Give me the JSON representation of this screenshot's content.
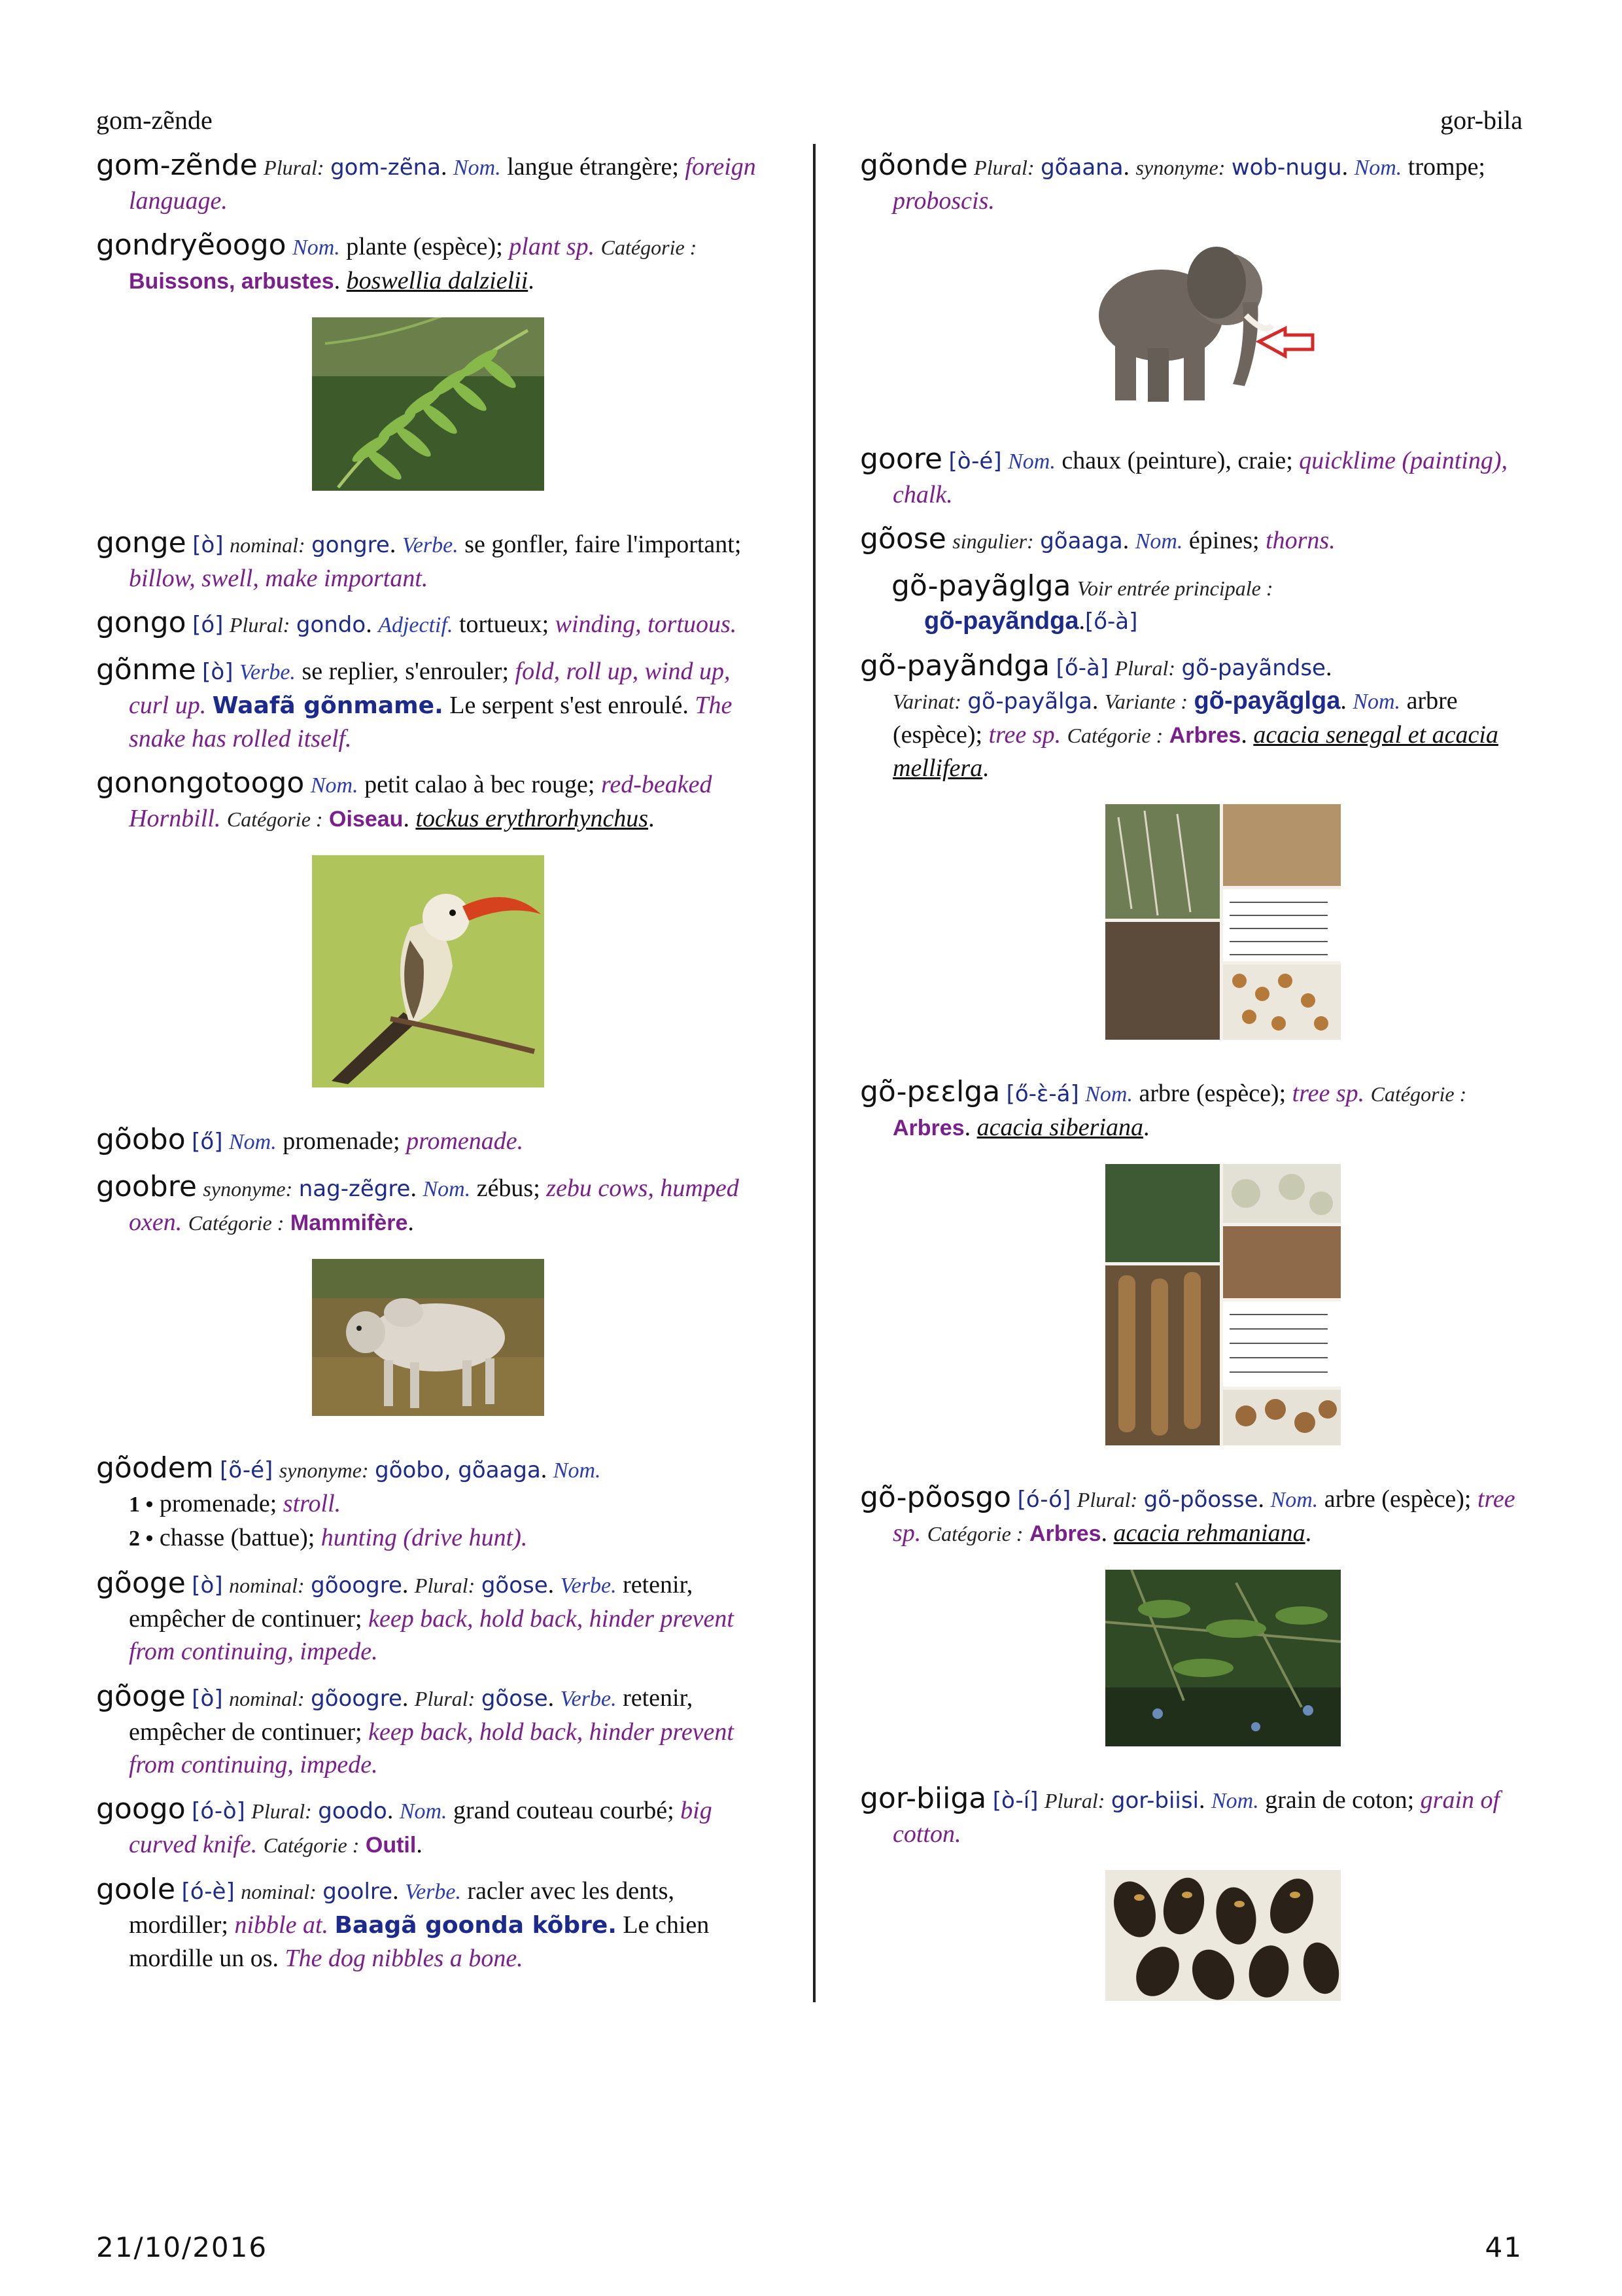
{
  "header": {
    "left": "gom-zẽnde",
    "right": "gor-bila"
  },
  "footer": {
    "date": "21/10/2016",
    "page": "41"
  },
  "left_entries": {
    "gomzende": {
      "hw": "gom-zẽnde",
      "plural_label": "Plural:",
      "plural": "gom-zẽna",
      "pos": "Nom.",
      "fr": "langue étrangère;",
      "en": "foreign language."
    },
    "gondryeoogo": {
      "hw": "gondryẽoogo",
      "pos": "Nom.",
      "fr": "plante (espèce);",
      "en": "plant sp.",
      "cat_label": "Catégorie :",
      "cat": "Buissons, arbustes",
      "sci": "boswellia dalzielii"
    },
    "gonge": {
      "hw": "gonge",
      "ph": "[ò]",
      "nominal_label": "nominal:",
      "nominal": "gongre",
      "pos": "Verbe.",
      "fr": "se gonfler, faire l'important;",
      "en": "billow, swell, make important."
    },
    "gongo": {
      "hw": "gongo",
      "ph": "[ó]",
      "plural_label": "Plural:",
      "plural": "gondo",
      "pos": "Adjectif.",
      "fr": "tortueux;",
      "en": "winding, tortuous."
    },
    "gonme": {
      "hw": "gõnme",
      "ph": "[ò]",
      "pos": "Verbe.",
      "fr": "se replier, s'enrouler;",
      "en": "fold, roll up, wind up, curl up.",
      "ex": "Waafã gõnmame.",
      "ex_fr": "Le serpent s'est enroulé.",
      "ex_en": "The snake has rolled itself."
    },
    "gonongotoogo": {
      "hw": "gonongotoogo",
      "pos": "Nom.",
      "fr": "petit calao à bec rouge;",
      "en": "red-beaked Hornbill.",
      "cat_label": "Catégorie :",
      "cat": "Oiseau",
      "sci": "tockus erythrorhynchus"
    },
    "goobo": {
      "hw": "gõobo",
      "ph": "[ő]",
      "pos": "Nom.",
      "fr": "promenade;",
      "en": "promenade."
    },
    "goobre": {
      "hw": "goobre",
      "syn_label": "synonyme:",
      "syn": "nag-zẽgre",
      "pos": "Nom.",
      "fr": "zébus;",
      "en": "zebu cows, humped oxen.",
      "cat_label": "Catégorie :",
      "cat": "Mammifère"
    },
    "goodem": {
      "hw": "gõodem",
      "ph": "[õ-é]",
      "syn_label": "synonyme:",
      "syn": "gõobo, gõaaga",
      "pos": "Nom.",
      "s1_num": "1 •",
      "s1_fr": "promenade;",
      "s1_en": "stroll.",
      "s2_num": "2 •",
      "s2_fr": "chasse (battue);",
      "s2_en": "hunting (drive hunt)."
    },
    "googe": {
      "hw": "gõoge",
      "ph": "[ò]",
      "nominal_label": "nominal:",
      "nominal": "gõoogre",
      "plural_label": "Plural:",
      "plural": "gõose",
      "pos": "Verbe.",
      "fr": "retenir, empêcher de continuer;",
      "en": "keep back, hold back, hinder prevent from continuing, impede."
    },
    "googo": {
      "hw": "googo",
      "ph": "[ó-ò]",
      "plural_label": "Plural:",
      "plural": "goodo",
      "pos": "Nom.",
      "fr": "grand couteau courbé;",
      "en": "big curved knife.",
      "cat_label": "Catégorie :",
      "cat": "Outil"
    },
    "goole": {
      "hw": "goole",
      "ph": "[ó-è]",
      "nominal_label": "nominal:",
      "nominal": "goolre",
      "pos": "Verbe.",
      "fr": "racler avec les dents, mordiller;",
      "en": "nibble at.",
      "ex": "Baagã goonda kõbre.",
      "ex_fr": "Le chien mordille un os.",
      "ex_en": "The dog nibbles a bone."
    }
  },
  "right_entries": {
    "goonde": {
      "hw": "gõonde",
      "plural_label": "Plural:",
      "plural": "gõaana",
      "syn_label": "synonyme:",
      "syn": "wob-nugu",
      "pos": "Nom.",
      "fr": "trompe;",
      "en": "proboscis."
    },
    "goore": {
      "hw": "goore",
      "ph": "[ò-é]",
      "pos": "Nom.",
      "fr": "chaux (peinture), craie;",
      "en": "quicklime (painting), chalk."
    },
    "goose": {
      "hw": "gõose",
      "sing_label": "singulier:",
      "sing": "gõaaga",
      "pos": "Nom.",
      "fr": "épines;",
      "en": "thorns."
    },
    "gopayagalga": {
      "hw": "gõ-payãglga",
      "see_label": "Voir entrée principale :",
      "see": "gõ-payãndga",
      "see_ph": "[ő-à]"
    },
    "gopayandga": {
      "hw": "gõ-payãndga",
      "ph": "[ő-à]",
      "plural_label": "Plural:",
      "plural": "gõ-payãndse",
      "var_label": "Varinat:",
      "var": "gõ-payãlga",
      "var2_label": "Variante :",
      "var2": "gõ-payãglga",
      "pos": "Nom.",
      "fr": "arbre (espèce);",
      "en": "tree sp.",
      "cat_label": "Catégorie :",
      "cat": "Arbres",
      "sci": "acacia senegal et acacia mellifera"
    },
    "gopeelga": {
      "hw": "gõ-pɛɛlga",
      "ph": "[ő-ɛ̀-á]",
      "pos": "Nom.",
      "fr": "arbre (espèce);",
      "en": "tree sp.",
      "cat_label": "Catégorie :",
      "cat": "Arbres",
      "sci": "acacia siberiana"
    },
    "gopoosgo": {
      "hw": "gõ-põosgo",
      "ph": "[ó-ó]",
      "plural_label": "Plural:",
      "plural": "gõ-põosse",
      "pos": "Nom.",
      "fr": "arbre (espèce);",
      "en": "tree sp.",
      "cat_label": "Catégorie :",
      "cat": "Arbres",
      "sci": "acacia rehmaniana"
    },
    "gorbiiga": {
      "hw": "gor-biiga",
      "ph": "[ò-í]",
      "plural_label": "Plural:",
      "plural": "gor-biisi",
      "pos": "Nom.",
      "fr": "grain de coton;",
      "en": "grain of cotton."
    }
  },
  "colors": {
    "headword": "#111111",
    "form": "#1b2a8c",
    "english": "#7a1f8c",
    "category": "#7a1f8c"
  }
}
